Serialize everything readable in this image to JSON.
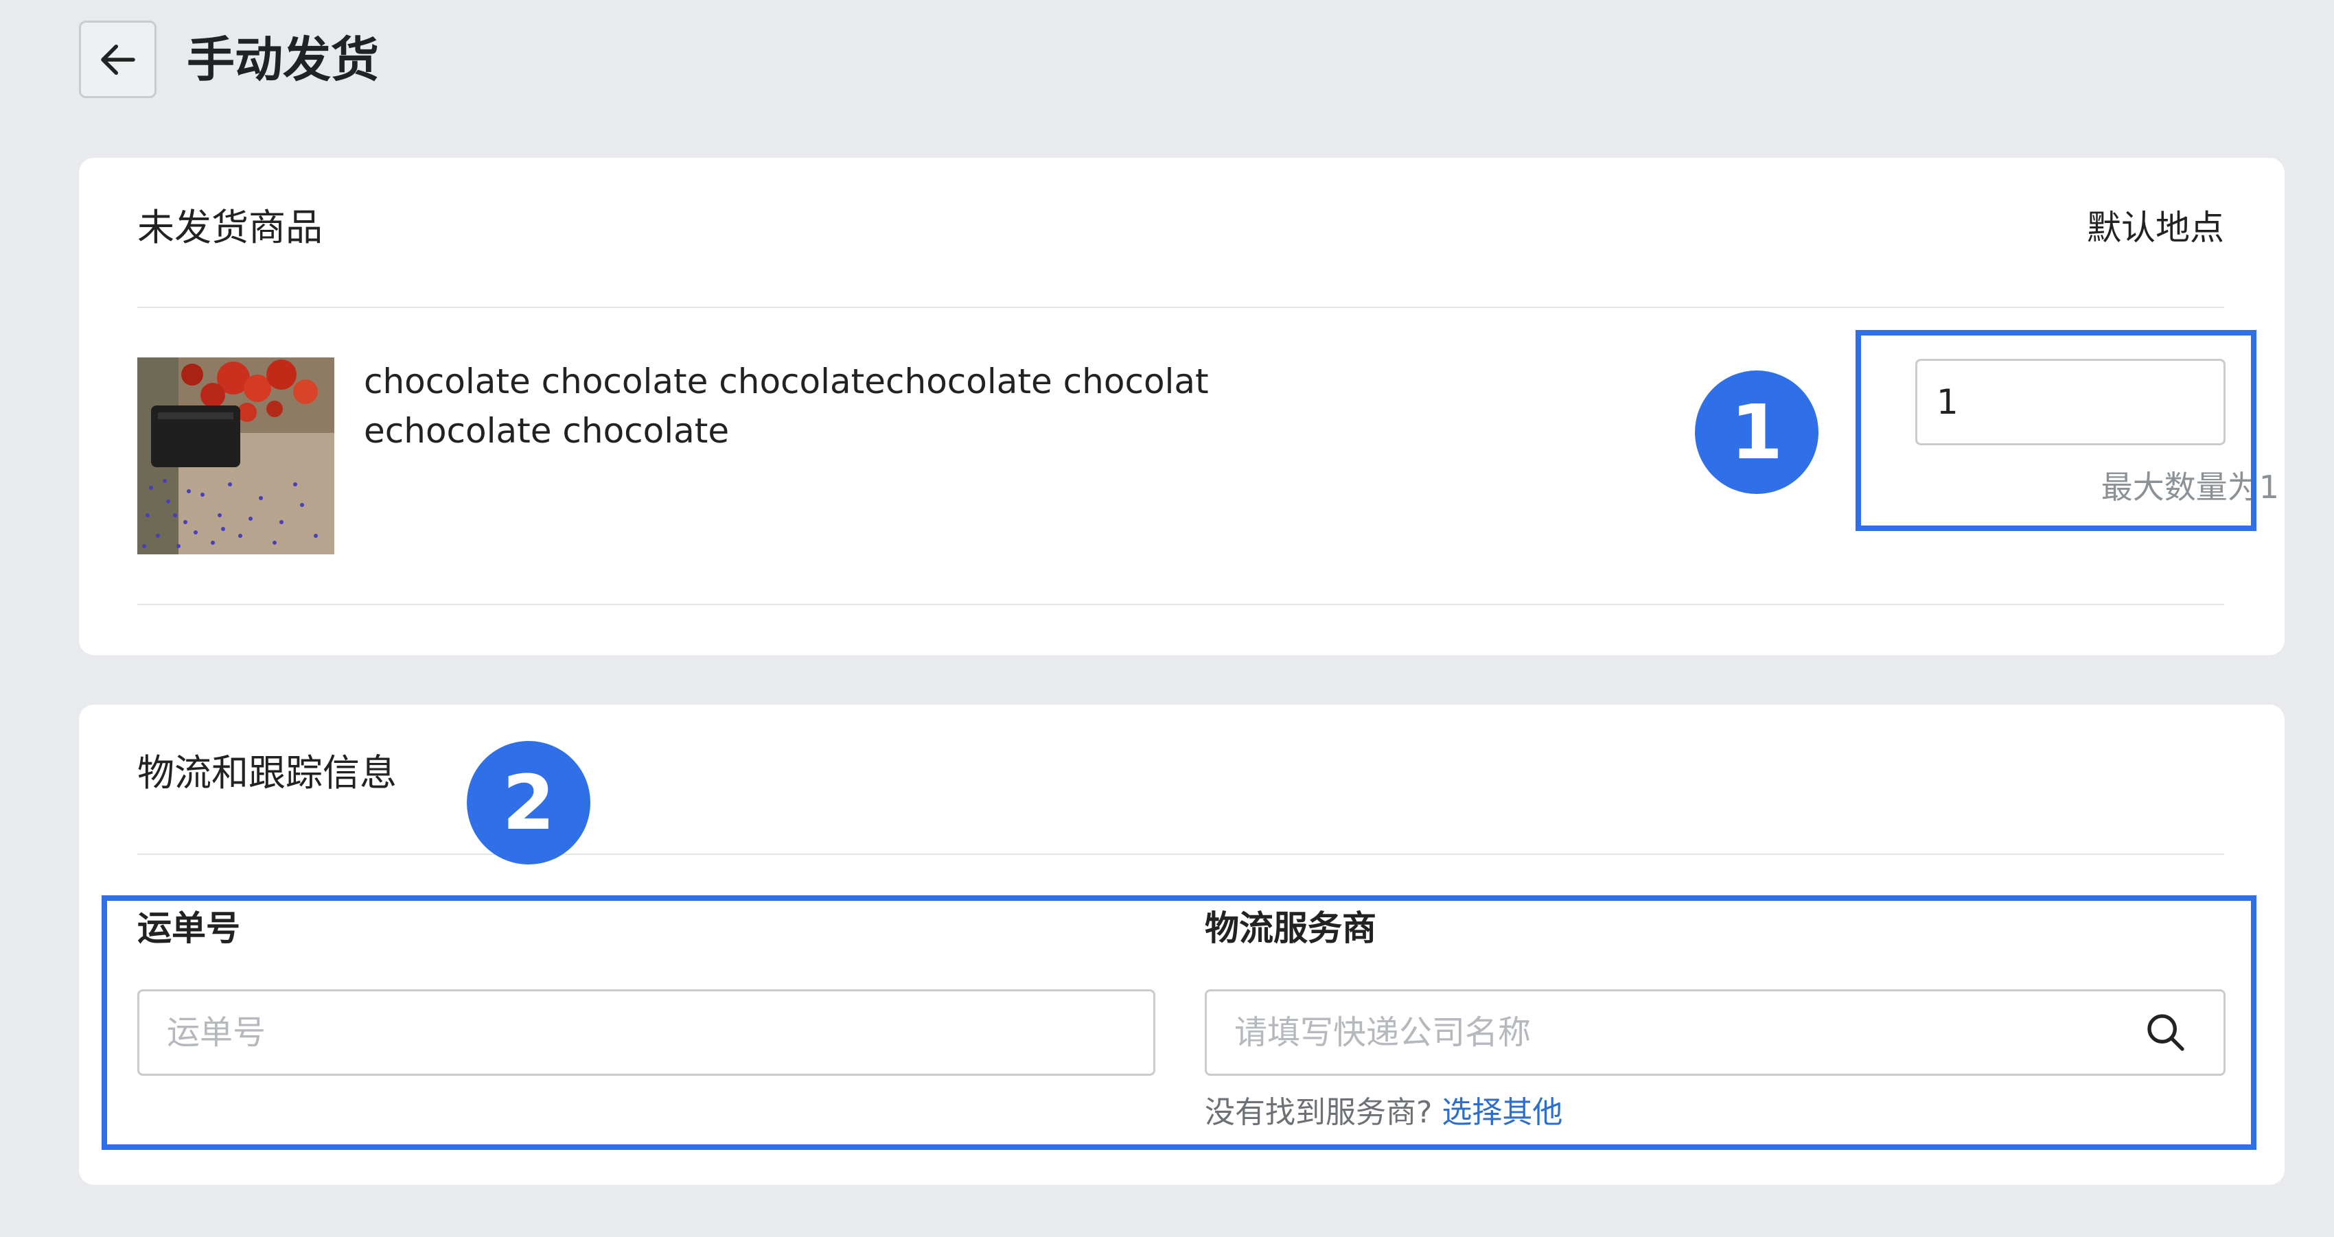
{
  "header": {
    "title": "手动发货",
    "back_icon": "arrow-left-icon"
  },
  "unfulfilled": {
    "heading": "未发货商品",
    "location": "默认地点",
    "item": {
      "name": "chocolate chocolate chocolatechocolate chocolatechocolate chocolate",
      "quantity": "1",
      "max_hint": "最大数量为1"
    }
  },
  "markers": [
    "1",
    "2"
  ],
  "shipping": {
    "heading": "物流和跟踪信息",
    "tracking_label": "运单号",
    "tracking_placeholder": "运单号",
    "carrier_label": "物流服务商",
    "carrier_placeholder": "请填写快递公司名称",
    "search_icon": "search-icon",
    "help_text": "没有找到服务商?",
    "help_link": "选择其他"
  },
  "colors": {
    "accent": "#2f6fe8",
    "link": "#2c6ecb",
    "background": "#e8eaed"
  }
}
